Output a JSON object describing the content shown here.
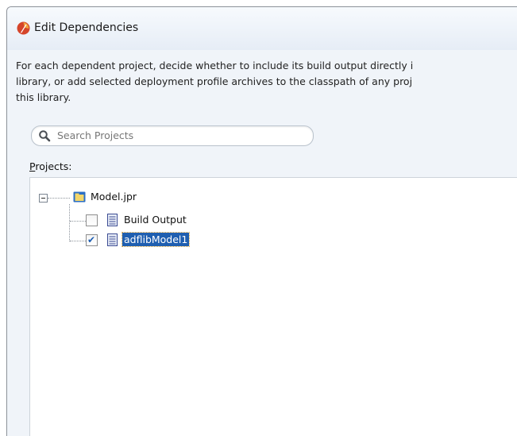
{
  "dialog": {
    "title": "Edit Dependencies",
    "description_lines": [
      "For each dependent project, decide whether to include its build output directly i",
      "library, or add selected deployment profile archives to the classpath of any proj",
      "this library."
    ]
  },
  "search": {
    "placeholder": "Search Projects"
  },
  "projects": {
    "label_mnemonic": "P",
    "label_rest": "rojects:",
    "root": {
      "label": "Model.jpr",
      "expanded": true
    },
    "children": [
      {
        "label": "Build Output",
        "checked": false,
        "selected": false
      },
      {
        "label": "adflibModel1",
        "checked": true,
        "selected": true
      }
    ]
  },
  "colors": {
    "selection": "#1f5fb0",
    "check": "#1e5fb3",
    "folder": "#e8c548"
  },
  "icons": [
    "app-icon",
    "search-icon",
    "folder-icon",
    "document-icon",
    "check-icon"
  ]
}
